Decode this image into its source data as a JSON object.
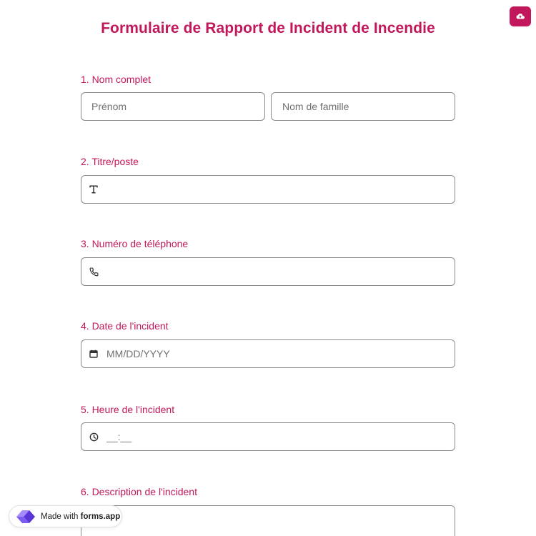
{
  "header": {
    "title": "Formulaire de Rapport de Incident de Incendie"
  },
  "questions": [
    {
      "label": "1.  Nom complet",
      "first_placeholder": "Prénom",
      "last_placeholder": "Nom de famille"
    },
    {
      "label": "2. Titre/poste",
      "icon": "text-icon"
    },
    {
      "label": "3. Numéro de téléphone",
      "icon": "phone-icon"
    },
    {
      "label": "4. Date de l'incident",
      "icon": "calendar-icon",
      "placeholder": "MM/DD/YYYY"
    },
    {
      "label": "5. Heure de l'incident",
      "icon": "clock-icon",
      "placeholder": "__:__"
    },
    {
      "label": "6. Description de l'incident"
    }
  ],
  "badge": {
    "prefix": "Made with",
    "brand": "forms.app"
  },
  "colors": {
    "accent": "#c2185b",
    "border": "#8a8a8a",
    "placeholder": "#6f6f6f"
  }
}
